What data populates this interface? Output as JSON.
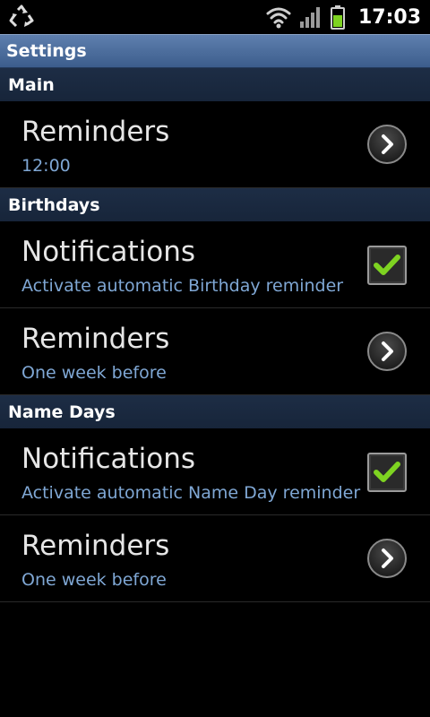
{
  "status_bar": {
    "time": "17:03",
    "left_icon": "recycle-icon",
    "icons": [
      "wifi-icon",
      "signal-icon",
      "battery-icon"
    ],
    "battery_color": "#7ed321"
  },
  "title_bar": {
    "title": "Settings"
  },
  "sections": [
    {
      "header": "Main",
      "rows": [
        {
          "title": "Reminders",
          "subtitle": "12:00",
          "control": "chevron"
        }
      ]
    },
    {
      "header": "Birthdays",
      "rows": [
        {
          "title": "Notifications",
          "subtitle": "Activate automatic Birthday reminder",
          "control": "checkbox",
          "checked": true
        },
        {
          "title": "Reminders",
          "subtitle": "One week before",
          "control": "chevron"
        }
      ]
    },
    {
      "header": "Name Days",
      "rows": [
        {
          "title": "Notifications",
          "subtitle": "Activate automatic Name Day reminder",
          "control": "checkbox",
          "checked": true
        },
        {
          "title": "Reminders",
          "subtitle": "One week before",
          "control": "chevron"
        }
      ]
    }
  ],
  "colors": {
    "subtitle": "#7fa7d4",
    "title_bar": "#4a6b9a",
    "section_header": "#1b2a41",
    "check": "#7ed321"
  }
}
